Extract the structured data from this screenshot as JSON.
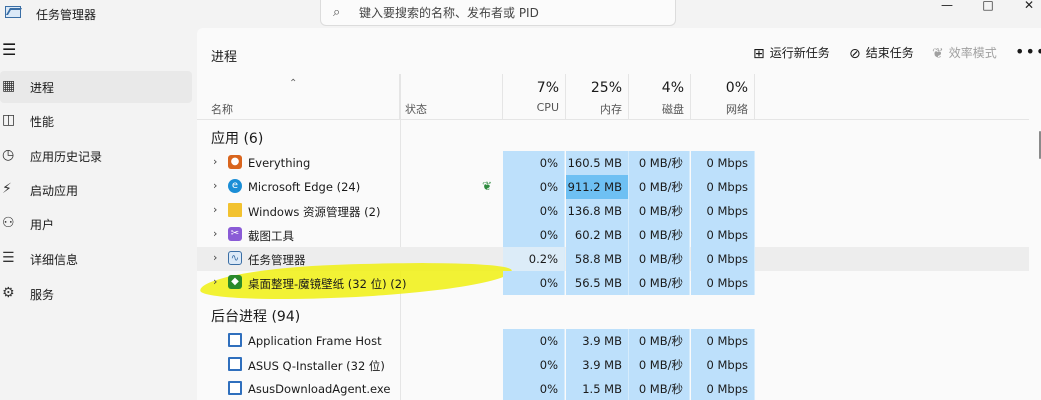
{
  "window": {
    "title": "任务管理器",
    "search_placeholder": "键入要搜索的名称、发布者或 PID",
    "minimize": "—",
    "maximize": "□",
    "close": "✕"
  },
  "sidebar": {
    "items": [
      {
        "label": "进程",
        "icon": "process-icon"
      },
      {
        "label": "性能",
        "icon": "performance-icon"
      },
      {
        "label": "应用历史记录",
        "icon": "history-icon"
      },
      {
        "label": "启动应用",
        "icon": "startup-icon"
      },
      {
        "label": "用户",
        "icon": "users-icon"
      },
      {
        "label": "详细信息",
        "icon": "details-icon"
      },
      {
        "label": "服务",
        "icon": "services-icon"
      }
    ]
  },
  "toolbar": {
    "page_title": "进程",
    "run_new_task": "运行新任务",
    "end_task": "结束任务",
    "efficiency_mode": "效率模式",
    "more": "•••"
  },
  "header": {
    "name": "名称",
    "status": "状态",
    "cpu_pct": "7%",
    "cpu": "CPU",
    "mem_pct": "25%",
    "mem": "内存",
    "disk_pct": "4%",
    "disk": "磁盘",
    "net_pct": "0%",
    "net": "网络"
  },
  "groups": {
    "apps_title": "应用 (6)",
    "background_title": "后台进程 (94)"
  },
  "apps": [
    {
      "name": "Everything",
      "cpu": "0%",
      "mem": "160.5 MB",
      "disk": "0 MB/秒",
      "net": "0 Mbps",
      "icon": "magnifier-icon",
      "color": "#d9651e"
    },
    {
      "name": "Microsoft Edge (24)",
      "cpu": "0%",
      "mem": "911.2 MB",
      "disk": "0 MB/秒",
      "net": "0 Mbps",
      "icon": "edge-icon",
      "color": "#1b8ed6",
      "status": "efficiency-leaf-icon"
    },
    {
      "name": "Windows 资源管理器 (2)",
      "cpu": "0%",
      "mem": "136.8 MB",
      "disk": "0 MB/秒",
      "net": "0 Mbps",
      "icon": "folder-icon",
      "color": "#f2c230"
    },
    {
      "name": "截图工具",
      "cpu": "0%",
      "mem": "60.2 MB",
      "disk": "0 MB/秒",
      "net": "0 Mbps",
      "icon": "scissors-icon",
      "color": "#8a5bd6"
    },
    {
      "name": "任务管理器",
      "cpu": "0.2%",
      "mem": "58.8 MB",
      "disk": "0 MB/秒",
      "net": "0 Mbps",
      "icon": "taskmgr-icon",
      "color": "#3a6ea5"
    },
    {
      "name": "桌面整理-魔镜壁纸 (32 位) (2)",
      "cpu": "0%",
      "mem": "56.5 MB",
      "disk": "0 MB/秒",
      "net": "0 Mbps",
      "icon": "cube-icon",
      "color": "#2a8a2a"
    }
  ],
  "background": [
    {
      "name": "Application Frame Host",
      "cpu": "0%",
      "mem": "3.9 MB",
      "disk": "0 MB/秒",
      "net": "0 Mbps",
      "icon": "app-window-icon",
      "color": "#2f6fbd"
    },
    {
      "name": "ASUS Q-Installer (32 位)",
      "cpu": "0%",
      "mem": "3.9 MB",
      "disk": "0 MB/秒",
      "net": "0 Mbps",
      "icon": "app-window-icon",
      "color": "#2f6fbd"
    },
    {
      "name": "AsusDownloadAgent.exe",
      "cpu": "0%",
      "mem": "1.5 MB",
      "disk": "0 MB/秒",
      "net": "0 Mbps",
      "icon": "app-window-icon",
      "color": "#2f6fbd"
    }
  ],
  "colors": {
    "heat_light": "#bde0fb",
    "heat_hot": "#6ec0f3",
    "annotation_highlight": "#f0f018"
  }
}
